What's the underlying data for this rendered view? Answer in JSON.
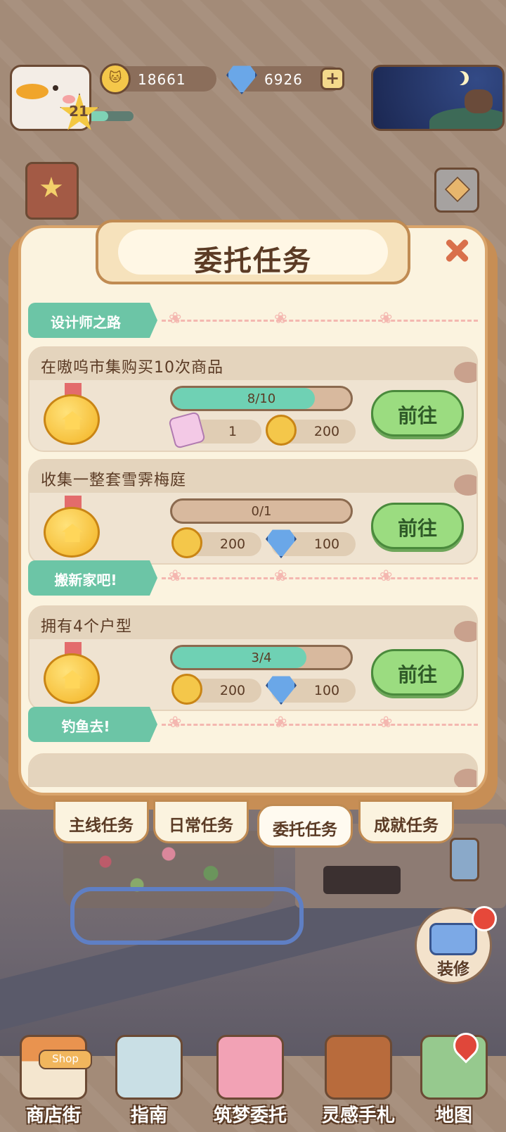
{
  "hud": {
    "level": "21",
    "coins": "18661",
    "gems": "6926",
    "plus": "+"
  },
  "dialog": {
    "title": "委托任务",
    "close": "×"
  },
  "sections": [
    {
      "label": "设计师之路"
    },
    {
      "label": "搬新家吧!"
    },
    {
      "label": "钓鱼去!"
    }
  ],
  "tasks": [
    {
      "title": "在嗷呜市集购买10次商品",
      "progress": "8/10",
      "progress_fraction": 0.8,
      "rewards": [
        {
          "icon": "ticket-icon",
          "amount": "1"
        },
        {
          "icon": "coin-icon",
          "amount": "200"
        }
      ],
      "button": "前往"
    },
    {
      "title": "收集一整套雪霁梅庭",
      "progress": "0/1",
      "progress_fraction": 0,
      "rewards": [
        {
          "icon": "coin-icon",
          "amount": "200"
        },
        {
          "icon": "gem-icon",
          "amount": "100"
        }
      ],
      "button": "前往"
    },
    {
      "title": "拥有4个户型",
      "progress": "3/4",
      "progress_fraction": 0.75,
      "rewards": [
        {
          "icon": "coin-icon",
          "amount": "200"
        },
        {
          "icon": "gem-icon",
          "amount": "100"
        }
      ],
      "button": "前往"
    }
  ],
  "tabs": [
    {
      "label": "主线任务",
      "active": false
    },
    {
      "label": "日常任务",
      "active": false
    },
    {
      "label": "委托任务",
      "active": true
    },
    {
      "label": "成就任务",
      "active": false
    }
  ],
  "side": {
    "remodel_label": "装修"
  },
  "bottom_nav": [
    {
      "label": "商店街",
      "icon": "shop-icon",
      "sign": "Shop"
    },
    {
      "label": "指南",
      "icon": "guide-icon"
    },
    {
      "label": "筑梦委托",
      "icon": "notebook-icon"
    },
    {
      "label": "灵感手札",
      "icon": "feather-book-icon"
    },
    {
      "label": "地图",
      "icon": "map-icon"
    }
  ],
  "colors": {
    "accent_green": "#6cc5a6",
    "go_button": "#9bdc80",
    "dialog_bg": "#fbf3df"
  }
}
